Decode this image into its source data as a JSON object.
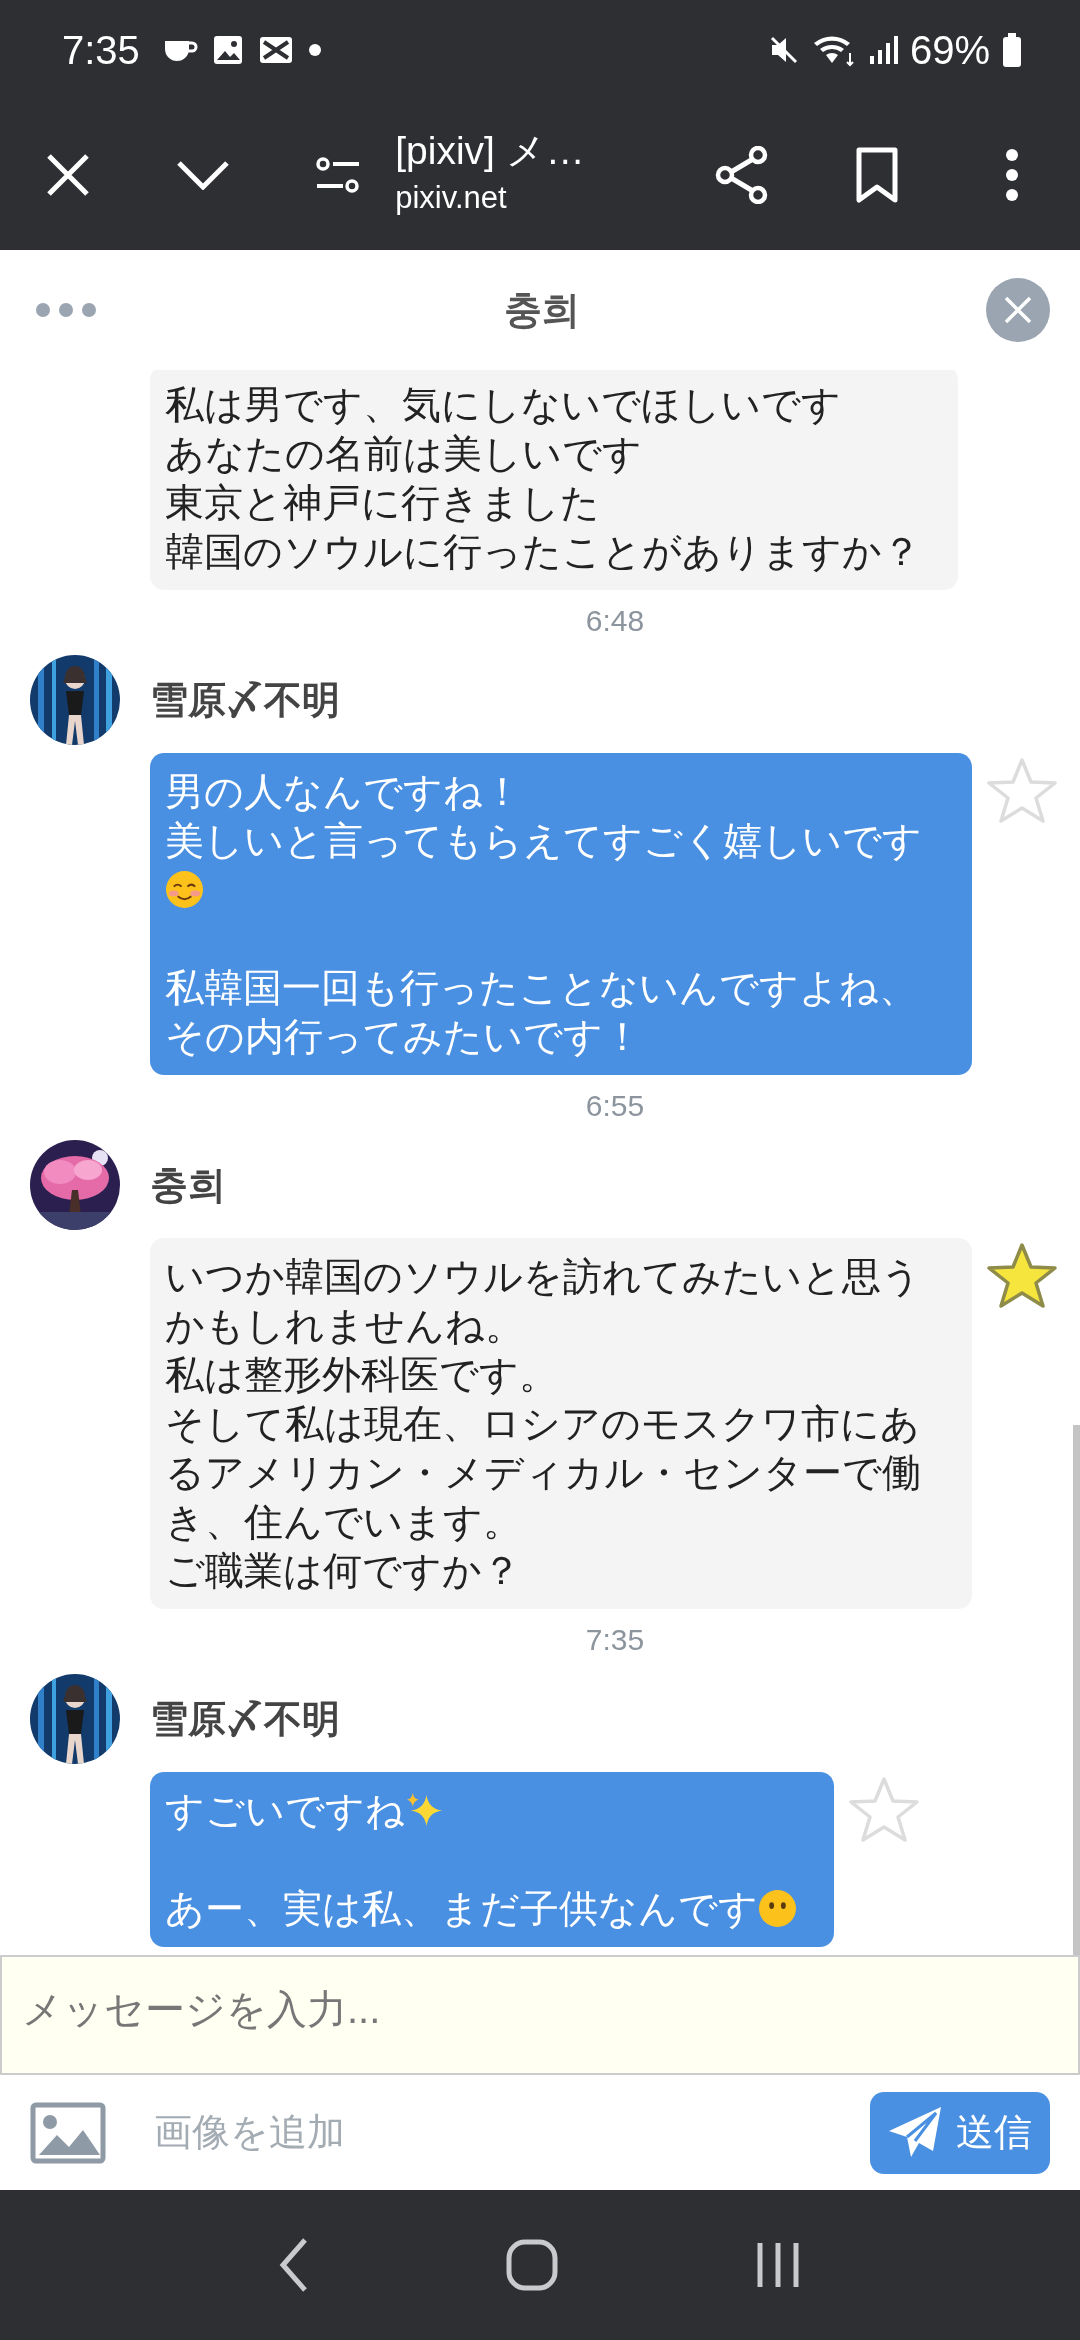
{
  "status_bar": {
    "time": "7:35",
    "battery": "69%"
  },
  "toolbar": {
    "title": "[pixiv] メ…",
    "domain": "pixiv.net"
  },
  "chat": {
    "title": "충희"
  },
  "messages": [
    {
      "outgoing": false,
      "lines": [
        {
          "kind": "plain",
          "text": "私は男です、気にしないでほしいです"
        },
        {
          "kind": "plain",
          "text": "あなたの名前は美しいです"
        },
        {
          "kind": "plain",
          "text": "東京と神戸に行きました"
        },
        {
          "kind": "plain",
          "text": "韓国のソウルに行ったことがありますか？"
        }
      ],
      "time": "6:48"
    },
    {
      "sender": "雪原〆不明",
      "outgoing": true,
      "starred": false,
      "lines": [
        {
          "kind": "plain",
          "text": "男の人なんですね！"
        },
        {
          "kind": "blush",
          "text": "美しいと言ってもらえてすごく嬉しいです"
        },
        {
          "kind": "blank"
        },
        {
          "kind": "plain",
          "text": "私韓国一回も行ったことないんですよね、"
        },
        {
          "kind": "plain",
          "text": "その内行ってみたいです！"
        }
      ],
      "time": "6:55"
    },
    {
      "sender": "충희",
      "outgoing": false,
      "starred": true,
      "lines": [
        {
          "kind": "plain",
          "text": "いつか韓国のソウルを訪れてみたいと思うかもしれませんね。"
        },
        {
          "kind": "plain",
          "text": "私は整形外科医です。"
        },
        {
          "kind": "plain",
          "text": "そして私は現在、ロシアのモスクワ市にあるアメリカン・メディカル・センターで働き、住んでいます。"
        },
        {
          "kind": "plain",
          "text": "ご職業は何ですか？"
        }
      ],
      "time": "7:35"
    },
    {
      "sender": "雪原〆不明",
      "outgoing": true,
      "starred": false,
      "lines": [
        {
          "kind": "sparkles",
          "text": "すごいですね"
        },
        {
          "kind": "blank"
        },
        {
          "kind": "no_mouth",
          "text": "あー、実は私、まだ子供なんです"
        }
      ]
    }
  ],
  "composer": {
    "placeholder": "メッセージを入力...",
    "attach_label": "画像を追加",
    "send_label": "送信"
  }
}
